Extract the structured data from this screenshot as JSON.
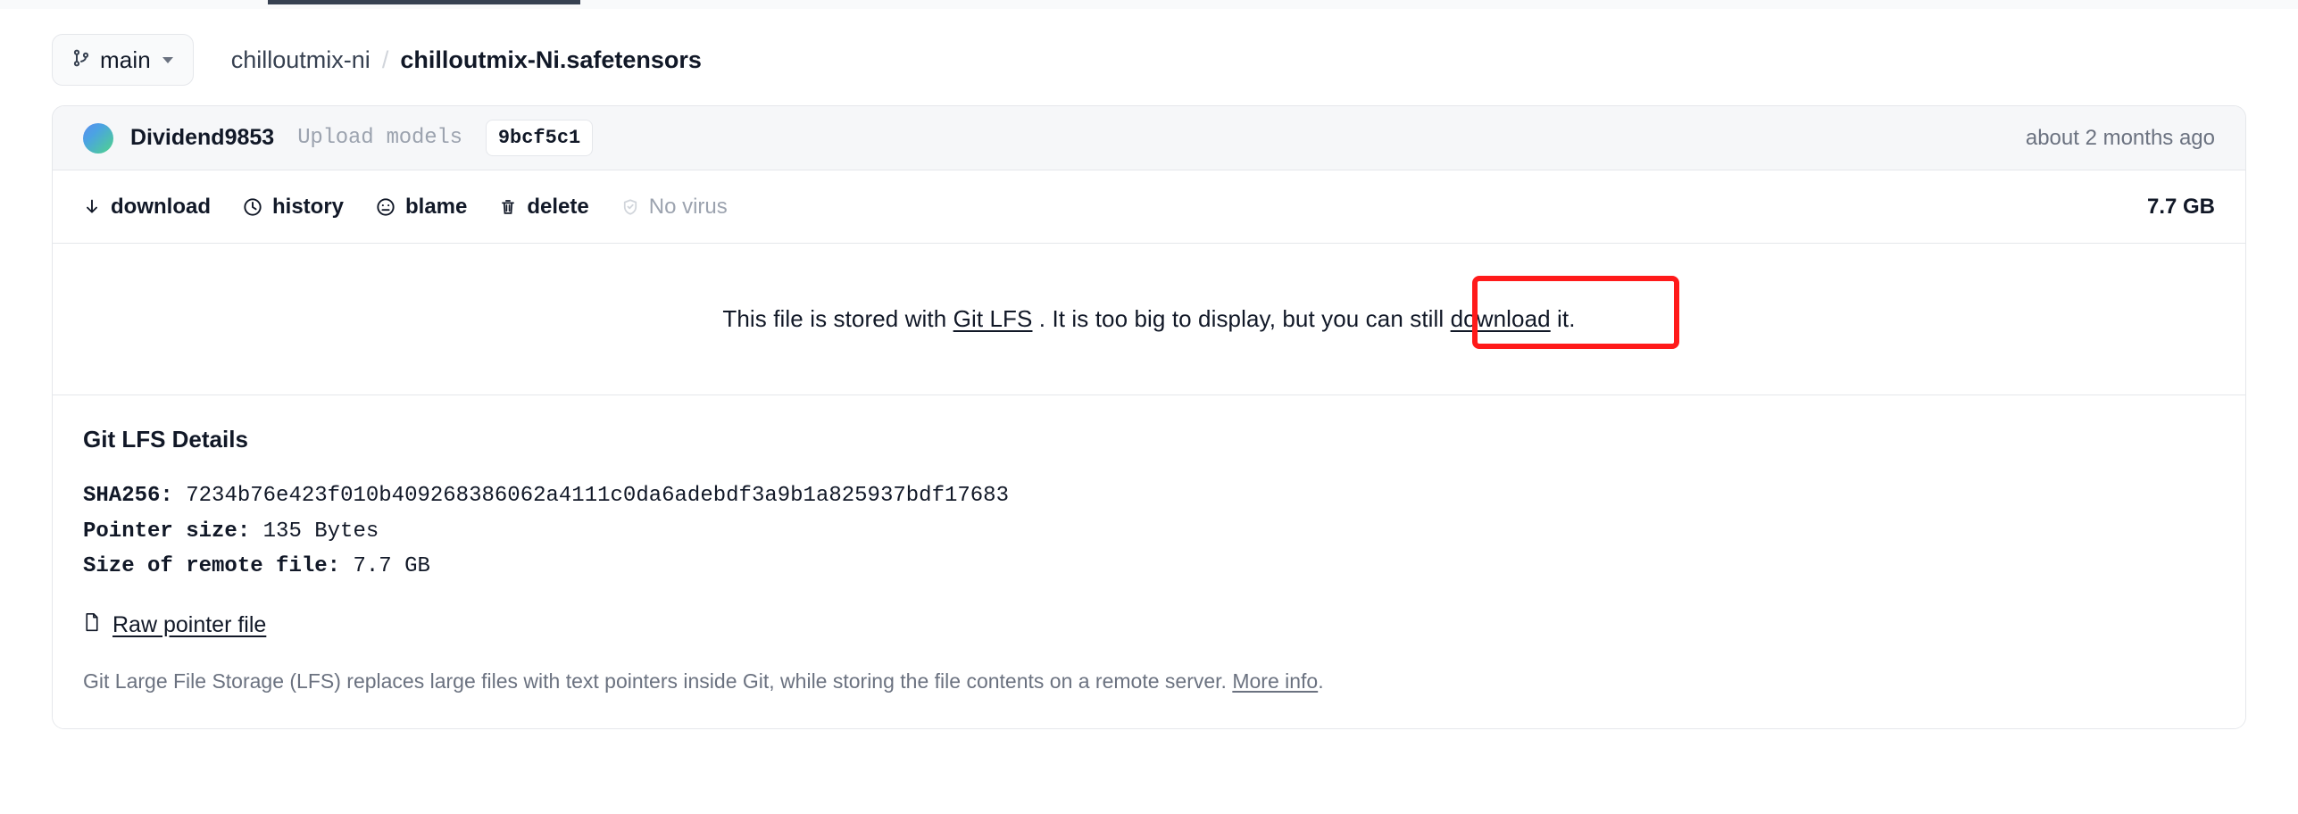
{
  "tabstrip": {
    "active_tab_indicator": "files-and-versions"
  },
  "breadcrumb": {
    "branch_button": {
      "label": "main",
      "icon": "git-branch-icon",
      "caret": "chevron-down-icon"
    },
    "repo": "chilloutmix-ni",
    "separator": "/",
    "file": "chilloutmix-Ni.safetensors"
  },
  "commit": {
    "author": "Dividend9853",
    "message": "Upload models",
    "sha": "9bcf5c1",
    "time": "about 2 months ago"
  },
  "actions": {
    "items": [
      {
        "label": "download",
        "icon": "download-arrow-icon",
        "disabled": false
      },
      {
        "label": "history",
        "icon": "clock-icon",
        "disabled": false
      },
      {
        "label": "blame",
        "icon": "face-icon",
        "disabled": false
      },
      {
        "label": "delete",
        "icon": "trash-icon",
        "disabled": false
      },
      {
        "label": "No virus",
        "icon": "shield-check-icon",
        "disabled": true
      }
    ],
    "file_size": "7.7 GB"
  },
  "lfs_notice": {
    "prefix": "This file is stored with ",
    "link_lfs": "Git LFS",
    "middle": " . It is too big to display, but you can still ",
    "link_download": "download",
    "suffix": " it.",
    "highlight_color": "#ff1a1a"
  },
  "details": {
    "title": "Git LFS Details",
    "rows": [
      {
        "key": "SHA256:",
        "value": "7234b76e423f010b409268386062a4111c0da6adebdf3a9b1a825937bdf17683"
      },
      {
        "key": "Pointer size:",
        "value": "135 Bytes"
      },
      {
        "key": "Size of remote file:",
        "value": "7.7 GB"
      }
    ],
    "raw_pointer": {
      "label": "Raw pointer file",
      "icon": "file-icon"
    },
    "footnote_prefix": "Git Large File Storage (LFS) replaces large files with text pointers inside Git, while storing the file contents on a remote server. ",
    "footnote_link": "More info",
    "footnote_suffix": "."
  }
}
